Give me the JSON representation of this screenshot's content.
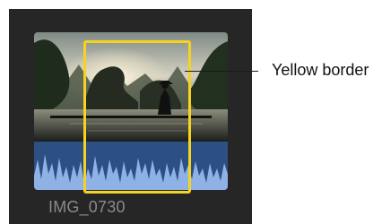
{
  "clip": {
    "name": "IMG_0730"
  },
  "callout": {
    "label": "Yellow border"
  },
  "colors": {
    "panel_background": "#262626",
    "selection_border": "#f5d31f",
    "audio_waveform": "#8fb2e6",
    "audio_background": "#2c4f84",
    "clip_name_text": "#8a8a8a",
    "callout_text": "#111111"
  }
}
